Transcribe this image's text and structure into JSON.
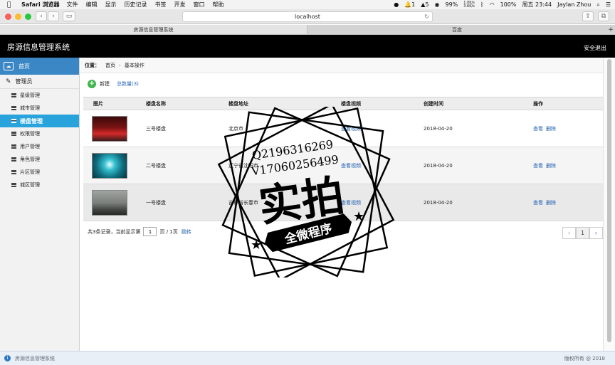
{
  "menubar": {
    "app_name": "Safari 浏览器",
    "menus": [
      "文件",
      "编辑",
      "显示",
      "历史记录",
      "书签",
      "开发",
      "窗口",
      "帮助"
    ],
    "status": {
      "notif1": "1",
      "notif2": "5",
      "battery_pct": "99%",
      "net_up": "1.0K/s",
      "net_down": "3.6K/s",
      "battery2": "100%",
      "clock": "周五 23:44",
      "user": "Jaylan Zhou"
    }
  },
  "browser": {
    "url": "localhost",
    "tabs": [
      "房源信息管理系统",
      "百度"
    ]
  },
  "header": {
    "title": "房源信息管理系统",
    "logout": "安全退出"
  },
  "sidebar": {
    "home": "首页",
    "admin": "管理员",
    "items": [
      {
        "label": "星级管理",
        "active": false
      },
      {
        "label": "城市管理",
        "active": false
      },
      {
        "label": "楼盘管理",
        "active": true
      },
      {
        "label": "权限管理",
        "active": false
      },
      {
        "label": "用户管理",
        "active": false
      },
      {
        "label": "角色管理",
        "active": false
      },
      {
        "label": "片区管理",
        "active": false
      },
      {
        "label": "城区管理",
        "active": false
      }
    ]
  },
  "breadcrumb": {
    "label": "位置：",
    "home": "首页",
    "current": "基本操作"
  },
  "actions": {
    "new": "新建",
    "count": "总数量(3)"
  },
  "table": {
    "headers": [
      "图片",
      "楼盘名称",
      "楼盘地址",
      "楼盘视频",
      "创建时间",
      "操作"
    ],
    "rows": [
      {
        "name": "三号楼盘",
        "address": "北京市",
        "video": "查看视频",
        "created": "2018-04-20",
        "view": "查看",
        "del": "删除"
      },
      {
        "name": "二号楼盘",
        "address": "辽宁省沈阳市",
        "video": "查看视频",
        "created": "2018-04-20",
        "view": "查看",
        "del": "删除"
      },
      {
        "name": "一号楼盘",
        "address": "吉林省长春市",
        "video": "查看视频",
        "created": "2018-04-20",
        "view": "查看",
        "del": "删除"
      }
    ]
  },
  "pager": {
    "summary": "共3条记录，",
    "current_prefix": "当前显示第",
    "page_value": "1",
    "total": "页 / 1页",
    "jump": "跳转",
    "cur_page": "1"
  },
  "footer": {
    "app": "房源信息管理系统",
    "copyright": "版权所有 @ 2018"
  },
  "watermark": {
    "line1": "Q2196316269",
    "line2": "V17060256499",
    "big": "实拍",
    "band": "全微程序"
  }
}
